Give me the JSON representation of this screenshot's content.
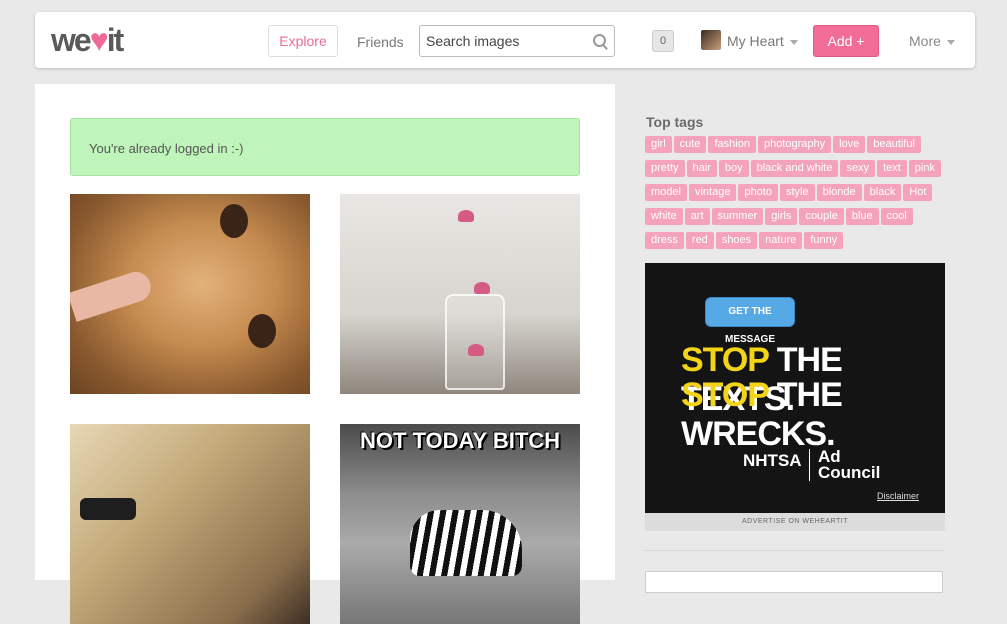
{
  "header": {
    "logo_pre": "we",
    "logo_post": "it",
    "explore": "Explore",
    "friends": "Friends",
    "search_placeholder": "Search images",
    "notifications": "0",
    "user": "My Heart",
    "add": "Add +",
    "more": "More"
  },
  "alert": "You're already logged in :-)",
  "grid": {
    "meme_text": "NOT TODAY BITCH"
  },
  "sidebar": {
    "tags_title": "Top tags",
    "tags": [
      "girl",
      "cute",
      "fashion",
      "photography",
      "love",
      "beautiful",
      "pretty",
      "hair",
      "boy",
      "black and white",
      "sexy",
      "text",
      "pink",
      "model",
      "vintage",
      "photo",
      "style",
      "blonde",
      "black",
      "Hot",
      "white",
      "art",
      "summer",
      "girls",
      "couple",
      "blue",
      "cool",
      "dress",
      "red",
      "shoes",
      "nature",
      "funny"
    ],
    "ad": {
      "bubble": "GET THE MESSAGE",
      "line1_a": "STOP",
      "line1_b": " THE TEXTS.",
      "line2_a": "STOP",
      "line2_b": " THE WRECKS.",
      "org1": "NHTSA",
      "org2": "Ad Council",
      "disclaimer": "Disclaimer",
      "footer": "ADVERTISE ON WEHEARTIT"
    }
  },
  "colors": {
    "brand_pink": "#f26d95",
    "tag_pink": "#f4a3bb",
    "alert_green": "#bff5bb",
    "ad_yellow": "#f4d416"
  }
}
